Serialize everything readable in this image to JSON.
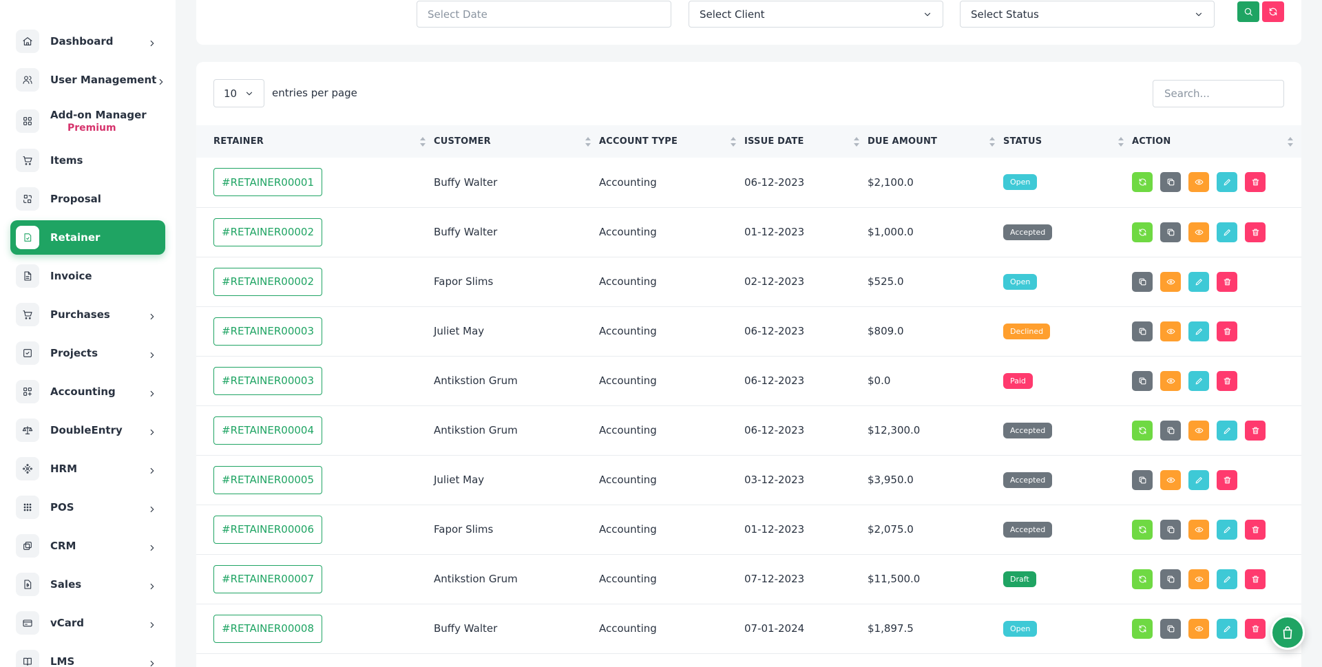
{
  "sidebar": {
    "items": [
      {
        "label": "Dashboard",
        "icon": "home-icon",
        "has_chevron": true
      },
      {
        "label": "User Management",
        "icon": "users-icon",
        "has_chevron": true
      },
      {
        "label": "Add-on Manager",
        "badge": "Premium",
        "icon": "grid-icon",
        "has_chevron": false
      },
      {
        "label": "Items",
        "icon": "cart-icon",
        "has_chevron": false
      },
      {
        "label": "Proposal",
        "icon": "proposal-icon",
        "has_chevron": false
      },
      {
        "label": "Retainer",
        "icon": "retainer-icon",
        "has_chevron": false,
        "active": true
      },
      {
        "label": "Invoice",
        "icon": "file-icon",
        "has_chevron": false
      },
      {
        "label": "Purchases",
        "icon": "cart-icon",
        "has_chevron": true
      },
      {
        "label": "Projects",
        "icon": "checkbox-icon",
        "has_chevron": true
      },
      {
        "label": "Accounting",
        "icon": "grid-plus-icon",
        "has_chevron": true
      },
      {
        "label": "DoubleEntry",
        "icon": "scale-icon",
        "has_chevron": true
      },
      {
        "label": "HRM",
        "icon": "hrm-icon",
        "has_chevron": true
      },
      {
        "label": "POS",
        "icon": "dots-grid-icon",
        "has_chevron": true
      },
      {
        "label": "CRM",
        "icon": "crm-icon",
        "has_chevron": true
      },
      {
        "label": "Sales",
        "icon": "sales-icon",
        "has_chevron": true
      },
      {
        "label": "vCard",
        "icon": "card-icon",
        "has_chevron": true
      },
      {
        "label": "LMS",
        "icon": "book-icon",
        "has_chevron": true
      }
    ]
  },
  "filters": {
    "date_placeholder": "Select Date",
    "client_label": "Select Client",
    "status_label": "Select Status"
  },
  "table_controls": {
    "entries_value": "10",
    "entries_label": "entries per page",
    "search_placeholder": "Search..."
  },
  "table": {
    "columns": [
      "RETAINER",
      "CUSTOMER",
      "ACCOUNT TYPE",
      "ISSUE DATE",
      "DUE AMOUNT",
      "STATUS",
      "ACTION"
    ],
    "rows": [
      {
        "retainer": "#RETAINER00001",
        "customer": "Buffy Walter",
        "account_type": "Accounting",
        "issue_date": "06-12-2023",
        "due_amount": "$2,100.0",
        "status": "Open",
        "convert": true
      },
      {
        "retainer": "#RETAINER00002",
        "customer": "Buffy Walter",
        "account_type": "Accounting",
        "issue_date": "01-12-2023",
        "due_amount": "$1,000.0",
        "status": "Accepted",
        "convert": true
      },
      {
        "retainer": "#RETAINER00002",
        "customer": "Fapor Slims",
        "account_type": "Accounting",
        "issue_date": "02-12-2023",
        "due_amount": "$525.0",
        "status": "Open",
        "convert": false
      },
      {
        "retainer": "#RETAINER00003",
        "customer": "Juliet May",
        "account_type": "Accounting",
        "issue_date": "06-12-2023",
        "due_amount": "$809.0",
        "status": "Declined",
        "convert": false
      },
      {
        "retainer": "#RETAINER00003",
        "customer": "Antikstion Grum",
        "account_type": "Accounting",
        "issue_date": "06-12-2023",
        "due_amount": "$0.0",
        "status": "Paid",
        "convert": false
      },
      {
        "retainer": "#RETAINER00004",
        "customer": "Antikstion Grum",
        "account_type": "Accounting",
        "issue_date": "06-12-2023",
        "due_amount": "$12,300.0",
        "status": "Accepted",
        "convert": true
      },
      {
        "retainer": "#RETAINER00005",
        "customer": "Juliet May",
        "account_type": "Accounting",
        "issue_date": "03-12-2023",
        "due_amount": "$3,950.0",
        "status": "Accepted",
        "convert": false
      },
      {
        "retainer": "#RETAINER00006",
        "customer": "Fapor Slims",
        "account_type": "Accounting",
        "issue_date": "01-12-2023",
        "due_amount": "$2,075.0",
        "status": "Accepted",
        "convert": true
      },
      {
        "retainer": "#RETAINER00007",
        "customer": "Antikstion Grum",
        "account_type": "Accounting",
        "issue_date": "07-12-2023",
        "due_amount": "$11,500.0",
        "status": "Draft",
        "convert": true
      },
      {
        "retainer": "#RETAINER00008",
        "customer": "Buffy Walter",
        "account_type": "Accounting",
        "issue_date": "07-01-2024",
        "due_amount": "$1,897.5",
        "status": "Open",
        "convert": true
      }
    ]
  },
  "colors": {
    "brand_green": "#1fa463",
    "open": "#3ec9d6",
    "accepted": "#6c757d",
    "declined": "#ff9f2e",
    "paid": "#ff3a6e",
    "draft": "#1fa463"
  }
}
